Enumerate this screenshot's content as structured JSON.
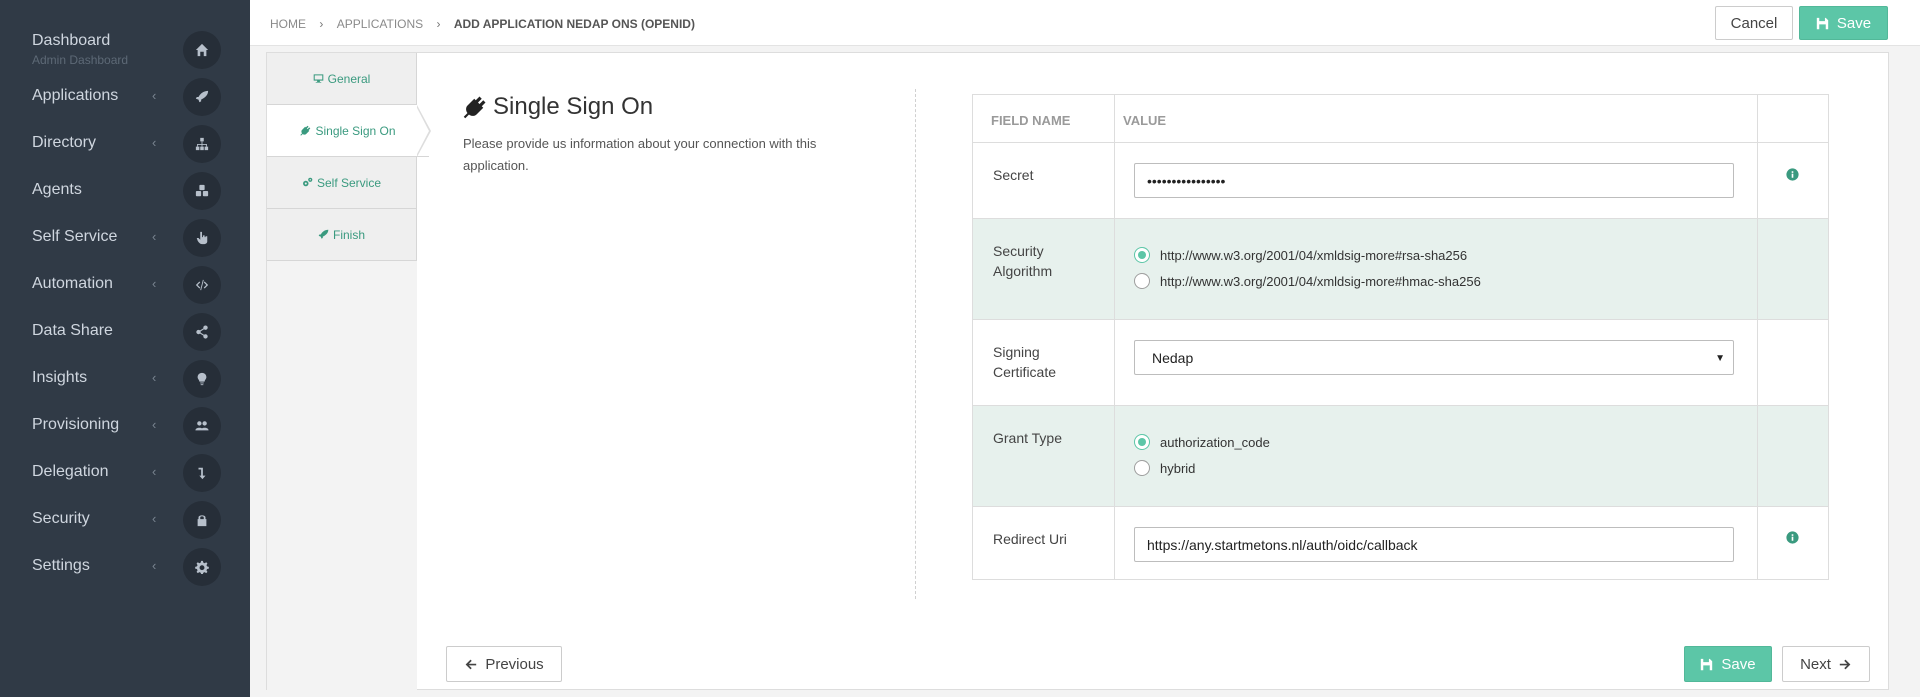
{
  "sidebar": {
    "items": [
      {
        "label": "Dashboard",
        "sub": "Admin Dashboard",
        "icon": "home-icon",
        "chevron": false
      },
      {
        "label": "Applications",
        "icon": "rocket-icon",
        "chevron": true
      },
      {
        "label": "Directory",
        "icon": "sitemap-icon",
        "chevron": true
      },
      {
        "label": "Agents",
        "icon": "cubes-icon",
        "chevron": false
      },
      {
        "label": "Self Service",
        "icon": "hand-pointer-icon",
        "chevron": true
      },
      {
        "label": "Automation",
        "icon": "code-icon",
        "chevron": true
      },
      {
        "label": "Data Share",
        "icon": "share-icon",
        "chevron": false
      },
      {
        "label": "Insights",
        "icon": "lightbulb-icon",
        "chevron": true
      },
      {
        "label": "Provisioning",
        "icon": "users-icon",
        "chevron": true
      },
      {
        "label": "Delegation",
        "icon": "level-down-icon",
        "chevron": true
      },
      {
        "label": "Security",
        "icon": "lock-icon",
        "chevron": true
      },
      {
        "label": "Settings",
        "icon": "gear-icon",
        "chevron": true
      }
    ],
    "chevron_glyph": "‹"
  },
  "breadcrumb": {
    "home": "HOME",
    "applications": "APPLICATIONS",
    "current": "ADD APPLICATION NEDAP ONS (OPENID)",
    "sep": "›"
  },
  "toolbar": {
    "cancel_label": "Cancel",
    "save_label": "Save"
  },
  "tabs": [
    {
      "label": "General",
      "icon": "desktop-icon"
    },
    {
      "label": "Single Sign On",
      "icon": "plug-icon",
      "active": true
    },
    {
      "label": "Self Service",
      "icon": "cogs-icon"
    },
    {
      "label": "Finish",
      "icon": "rocket-icon"
    }
  ],
  "section": {
    "title": "Single Sign On",
    "description": "Please provide us information about your connection with this application."
  },
  "table": {
    "headers": {
      "field_name": "FIELD NAME",
      "value": "VALUE"
    },
    "secret": {
      "label": "Secret",
      "value": "••••••••••••••••"
    },
    "security_algorithm": {
      "label": "Security Algorithm",
      "options": [
        {
          "label": "http://www.w3.org/2001/04/xmldsig-more#rsa-sha256",
          "selected": true
        },
        {
          "label": "http://www.w3.org/2001/04/xmldsig-more#hmac-sha256",
          "selected": false
        }
      ]
    },
    "signing_certificate": {
      "label": "Signing Certificate",
      "value": "Nedap"
    },
    "grant_type": {
      "label": "Grant Type",
      "options": [
        {
          "label": "authorization_code",
          "selected": true
        },
        {
          "label": "hybrid",
          "selected": false
        }
      ]
    },
    "redirect_uri": {
      "label": "Redirect Uri",
      "value": "https://any.startmetons.nl/auth/oidc/callback"
    }
  },
  "footer": {
    "previous_label": "Previous",
    "save_label": "Save",
    "next_label": "Next"
  },
  "colors": {
    "sidebar_bg": "#303a46",
    "accent": "#5cc6a7",
    "row_highlight": "#e7f1ed"
  }
}
